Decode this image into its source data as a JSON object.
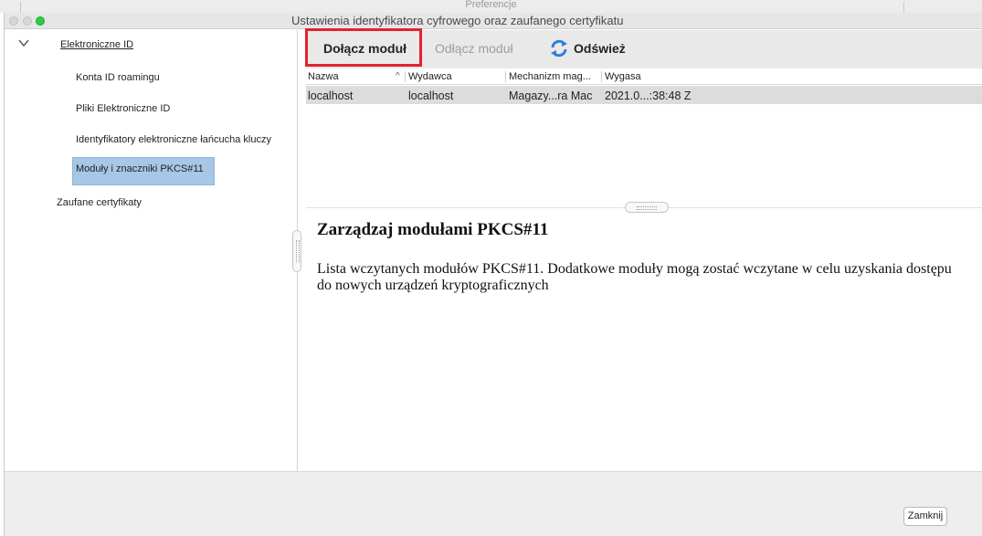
{
  "background_window": {
    "title": "Preferencje"
  },
  "window": {
    "title": "Ustawienia identyfikatora cyfrowego oraz zaufanego certyfikatu"
  },
  "sidebar": {
    "root": "Elektroniczne ID",
    "items": [
      {
        "label": "Konta ID roamingu"
      },
      {
        "label": "Pliki Elektroniczne ID"
      },
      {
        "label": "Identyfikatory elektroniczne łańcucha kluczy"
      },
      {
        "label": "Moduły i znaczniki PKCS#11",
        "selected": true
      },
      {
        "label": "Zaufane certyfikaty"
      }
    ]
  },
  "toolbar": {
    "attach_label": "Dołącz moduł",
    "detach_label": "Odłącz moduł",
    "refresh_label": "Odśwież"
  },
  "table": {
    "columns": [
      "Nazwa",
      "Wydawca",
      "Mechanizm mag...",
      "Wygasa"
    ],
    "rows": [
      [
        "localhost",
        "localhost",
        "Magazy...ra Mac",
        "2021.0...:38:48 Z"
      ]
    ]
  },
  "description": {
    "title": "Zarządzaj modułami PKCS#11",
    "text": "Lista wczytanych modułów PKCS#11. Dodatkowe moduły mogą zostać wczytane w celu uzyskania dostępu do nowych urządzeń kryptograficznych"
  },
  "footer": {
    "close_label": "Zamknij"
  },
  "colors": {
    "highlight": "#e0242d",
    "selection": "#a6c8e6",
    "refresh_icon": "#2f7fd6"
  }
}
